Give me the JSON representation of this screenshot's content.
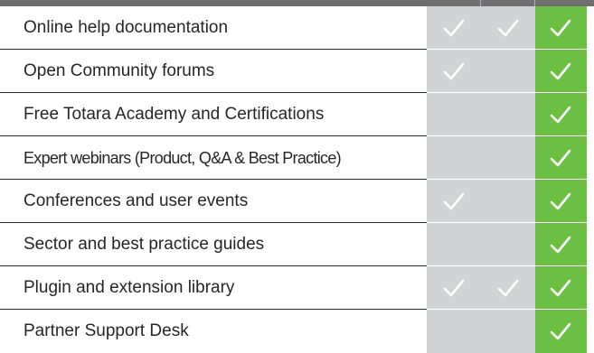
{
  "colors": {
    "header_bar": "#6f6f6f",
    "basic_column": "#d2d3d5",
    "premium_column": "#6bbf45",
    "check_mark": "#ffffff",
    "text": "#262626"
  },
  "rows": [
    {
      "label": "Online help documentation",
      "checks": [
        true,
        true,
        true
      ]
    },
    {
      "label": "Open Community forums",
      "checks": [
        true,
        false,
        true
      ]
    },
    {
      "label": "Free Totara Academy and Certifications",
      "checks": [
        false,
        false,
        true
      ]
    },
    {
      "label": "Expert webinars (Product, Q&A & Best Practice)",
      "checks": [
        false,
        false,
        true
      ]
    },
    {
      "label": "Conferences and user events",
      "checks": [
        true,
        false,
        true
      ]
    },
    {
      "label": "Sector and best practice guides",
      "checks": [
        false,
        false,
        true
      ]
    },
    {
      "label": "Plugin and extension library",
      "checks": [
        true,
        true,
        true
      ]
    },
    {
      "label": "Partner Support Desk",
      "checks": [
        false,
        false,
        true
      ]
    }
  ],
  "check_icon": "checkmark-icon"
}
